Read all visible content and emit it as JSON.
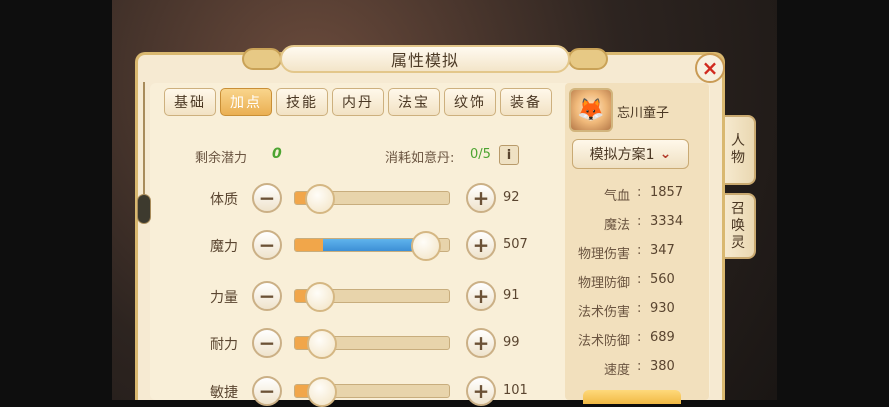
{
  "window": {
    "title": "属性模拟",
    "close_icon": "×"
  },
  "tabs": [
    {
      "label": "基础",
      "active": false
    },
    {
      "label": "加点",
      "active": true
    },
    {
      "label": "技能",
      "active": false
    },
    {
      "label": "内丹",
      "active": false
    },
    {
      "label": "法宝",
      "active": false
    },
    {
      "label": "纹饰",
      "active": false
    },
    {
      "label": "装备",
      "active": false
    }
  ],
  "potential": {
    "label": "剩余潜力",
    "value": "0"
  },
  "consume": {
    "label": "消耗如意丹:",
    "value": "0/5",
    "info_icon": "i"
  },
  "stats": [
    {
      "name": "体质",
      "value": "92",
      "fraction": 0.16,
      "blue": false
    },
    {
      "name": "魔力",
      "value": "507",
      "fraction": 0.84,
      "blue": true
    },
    {
      "name": "力量",
      "value": "91",
      "fraction": 0.16,
      "blue": false
    },
    {
      "name": "耐力",
      "value": "99",
      "fraction": 0.17,
      "blue": false
    },
    {
      "name": "敏捷",
      "value": "101",
      "fraction": 0.17,
      "blue": false
    }
  ],
  "buttons": {
    "minus": "−",
    "plus": "+"
  },
  "pet": {
    "name": "忘川童子",
    "avatar_icon": "fox-face-icon"
  },
  "scheme": {
    "label": "模拟方案1",
    "chevron": "⌄"
  },
  "attributes": [
    {
      "name": "气血",
      "value": "1857"
    },
    {
      "name": "魔法",
      "value": "3334"
    },
    {
      "name": "物理伤害",
      "value": "347"
    },
    {
      "name": "物理防御",
      "value": "560"
    },
    {
      "name": "法术伤害",
      "value": "930"
    },
    {
      "name": "法术防御",
      "value": "689"
    },
    {
      "name": "速度",
      "value": "380"
    }
  ],
  "colon": ":",
  "side_tabs": [
    {
      "label": [
        "人",
        "物"
      ]
    },
    {
      "label": [
        "召",
        "唤",
        "灵"
      ]
    }
  ],
  "colors": {
    "accent": "#f1a64a",
    "magic": "#3d8fd6",
    "potential": "#4da431",
    "close": "#d12a1f"
  }
}
